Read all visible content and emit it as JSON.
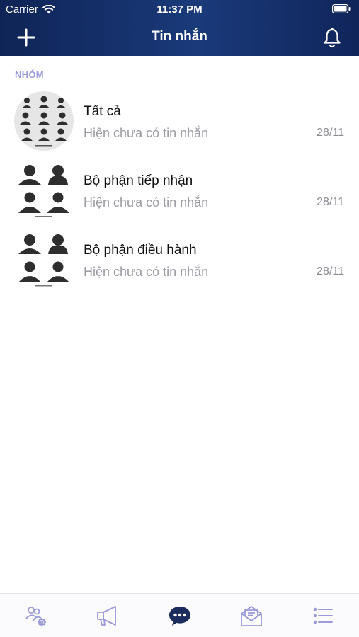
{
  "status_bar": {
    "carrier": "Carrier",
    "time": "11:37 PM"
  },
  "nav": {
    "title": "Tin nhắn"
  },
  "section": {
    "label": "NHÓM"
  },
  "groups": [
    {
      "name": "Tất cả",
      "preview": "Hiện chưa có tin nhắn",
      "date": "28/11"
    },
    {
      "name": "Bộ phận tiếp nhận",
      "preview": "Hiện chưa có tin nhắn",
      "date": "28/11"
    },
    {
      "name": "Bộ phận điều hành",
      "preview": "Hiện chưa có tin nhắn",
      "date": "28/11"
    }
  ],
  "tabs": [
    {
      "icon": "users-settings-icon",
      "active": false
    },
    {
      "icon": "megaphone-icon",
      "active": false
    },
    {
      "icon": "chat-bubble-icon",
      "active": true
    },
    {
      "icon": "mail-open-icon",
      "active": false
    },
    {
      "icon": "list-menu-icon",
      "active": false
    }
  ],
  "colors": {
    "header": "#1a3a7a",
    "accent": "#9a9ad8",
    "tab_active": "#1c2c5c",
    "tab_inactive": "#9a9ad8"
  }
}
